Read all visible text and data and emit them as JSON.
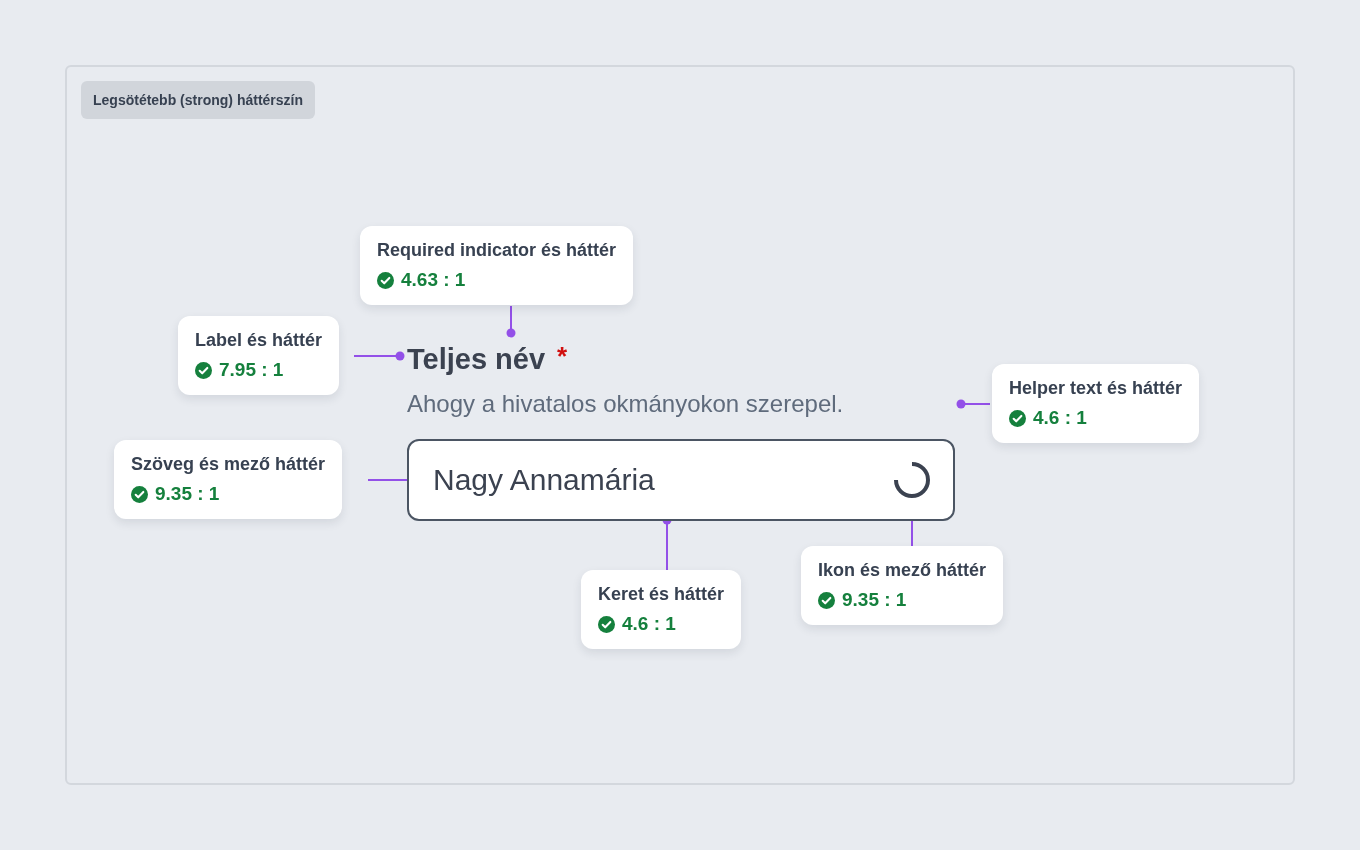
{
  "badge": "Legsötétebb (strong) háttérszín",
  "field": {
    "label": "Teljes név",
    "required": true,
    "required_mark": "*",
    "helper": "Ahogy a hivatalos okmányokon szerepel.",
    "value": "Nagy Annamária",
    "loading": true
  },
  "callouts": [
    {
      "title": "Required indicator és háttér",
      "ratio": "4.63 : 1",
      "passed": true
    },
    {
      "title": "Label és háttér",
      "ratio": "7.95 : 1",
      "passed": true
    },
    {
      "title": "Helper text és háttér",
      "ratio": "4.6 : 1",
      "passed": true
    },
    {
      "title": "Szöveg és mező háttér",
      "ratio": "9.35 : 1",
      "passed": true
    },
    {
      "title": "Keret és háttér",
      "ratio": "4.6 : 1",
      "passed": true
    },
    {
      "title": "Ikon és mező háttér",
      "ratio": "9.35 : 1",
      "passed": true
    }
  ]
}
